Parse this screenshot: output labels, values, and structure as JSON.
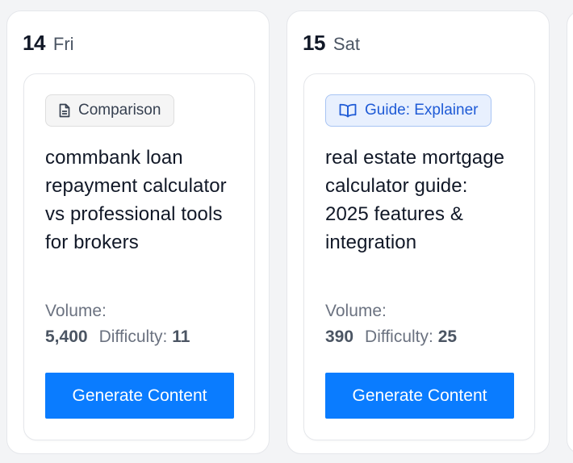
{
  "days": [
    {
      "number": "14",
      "weekday": "Fri",
      "card": {
        "badge": {
          "label": "Comparison",
          "icon": "document-icon",
          "color": "#374151"
        },
        "title": "commbank loan repayment calculator vs professional tools for brokers",
        "volume_label": "Volume:",
        "volume": "5,400",
        "difficulty_label": "Difficulty:",
        "difficulty": "11",
        "button_label": "Generate Content"
      }
    },
    {
      "number": "15",
      "weekday": "Sat",
      "card": {
        "badge": {
          "label": "Guide: Explainer",
          "icon": "book-open-icon",
          "color": "#1f5bd6"
        },
        "title": "real estate mortgage calculator guide: 2025 features & integration",
        "volume_label": "Volume:",
        "volume": "390",
        "difficulty_label": "Difficulty:",
        "difficulty": "25",
        "button_label": "Generate Content"
      }
    }
  ],
  "colors": {
    "accent": "#0a7cff",
    "page_background": "#f3f4f6",
    "card_border": "#e5e7eb"
  }
}
